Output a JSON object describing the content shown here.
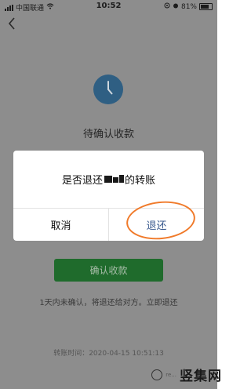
{
  "status_bar": {
    "carrier": "中国联通",
    "time": "10:52",
    "battery": "81%"
  },
  "page": {
    "back_icon": "chevron-left-icon",
    "pending_title": "待确认收款",
    "confirm_button": "确认收款",
    "note": "1天内未确认，将退还给对方。立即退还",
    "transfer_time": "转账时间：2020-04-15 10:51:13"
  },
  "dialog": {
    "message_prefix": "是否退还",
    "message_suffix": "的转账",
    "cancel_label": "取消",
    "refund_label": "退还"
  },
  "watermark": {
    "small_text": "re...",
    "big_text": "竖集网"
  },
  "colors": {
    "accent_green": "#1f6b2c",
    "refund_blue": "#3b5b8f",
    "annotation_orange": "#f07a2a",
    "clock_blue": "#2f5f83"
  }
}
